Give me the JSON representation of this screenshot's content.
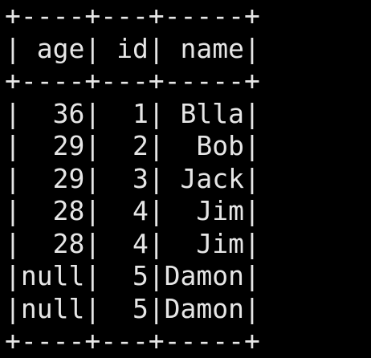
{
  "terminal": {
    "lines": [
      "+----+---+-----+",
      "| age| id| name|",
      "+----+---+-----+",
      "|  36|  1| Blla|",
      "|  29|  2|  Bob|",
      "|  29|  3| Jack|",
      "|  28|  4|  Jim|",
      "|  28|  4|  Jim|",
      "|null|  5|Damon|",
      "|null|  5|Damon|",
      "+----+---+-----+"
    ]
  },
  "colors": {
    "background": "#000000",
    "text": "#e6e6e6"
  }
}
